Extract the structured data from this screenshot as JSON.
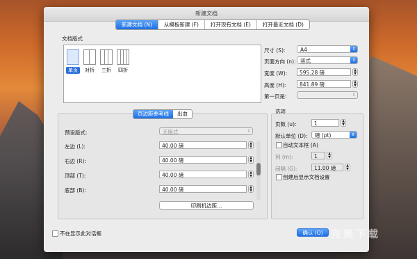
{
  "window": {
    "title": "新建文档"
  },
  "top_tabs": [
    "新建文档 (N)",
    "从模板新建 (F)",
    "打开现有文档 (E)",
    "打开最近文档 (D)"
  ],
  "layout_section": {
    "label": "文档版式",
    "thumbs": [
      {
        "label": "单页",
        "selected": true
      },
      {
        "label": "对折",
        "selected": false
      },
      {
        "label": "三折",
        "selected": false
      },
      {
        "label": "四折",
        "selected": false
      }
    ]
  },
  "size_panel": {
    "size_label": "尺寸 (S):",
    "size_value": "A4",
    "orientation_label": "页面方向 (n):",
    "orientation_value": "竖式",
    "width_label": "宽度 (W):",
    "width_value": "595.28 磅",
    "height_label": "高度 (H):",
    "height_value": "841.89 磅",
    "first_page_label": "第一页是:",
    "first_page_value": ""
  },
  "margin_tabs": [
    "页边距参考线",
    "出血"
  ],
  "margins": {
    "preset_label": "预设版式:",
    "preset_value": "无版式",
    "left_label": "左边 (L):",
    "left_value": "40.00 磅",
    "right_label": "右边 (R):",
    "right_value": "40.00 磅",
    "top_label": "顶部 (T):",
    "top_value": "40.00 磅",
    "bottom_label": "底部 (B):",
    "bottom_value": "40.00 磅",
    "printer_button": "印刷机边距..."
  },
  "options": {
    "label": "选项",
    "pages_label": "页数 (u):",
    "pages_value": "1",
    "unit_label": "默认单位 (D):",
    "unit_value": "磅 (pt)",
    "auto_text_label": "自动文本框 (A)",
    "columns_label": "列 (m):",
    "columns_value": "1",
    "gutter_label": "间隔 (G):",
    "gutter_value": "11.00 磅",
    "show_after_label": "创建后显示文档设置"
  },
  "footer": {
    "no_show_label": "不在显示此对话框",
    "ok_button": "确认 (O)"
  },
  "watermark_text": "完美下载",
  "colors": {
    "accent": "#1f70e6"
  }
}
